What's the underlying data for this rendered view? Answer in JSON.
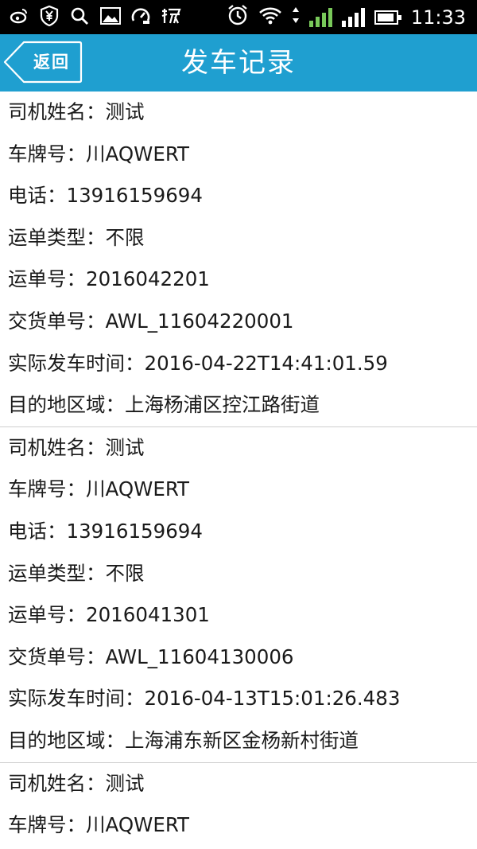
{
  "status_bar": {
    "left_icons": [
      "weibo-icon",
      "yen-shield-icon",
      "search-icon",
      "image-icon",
      "speed-icon",
      "taobao-icon"
    ],
    "right_icons": [
      "alarm-icon",
      "wifi-icon",
      "signal-1-icon",
      "signal-2-icon",
      "battery-icon"
    ],
    "time": "11:33"
  },
  "header": {
    "back_label": "返回",
    "title": "发车记录",
    "color": "#1f9fd0"
  },
  "records": [
    {
      "fields": [
        {
          "label": "司机姓名：",
          "value": "测试"
        },
        {
          "label": "车牌号：",
          "value": "川AQWERT"
        },
        {
          "label": "电话：",
          "value": "13916159694"
        },
        {
          "label": "运单类型：",
          "value": "不限"
        },
        {
          "label": "运单号：",
          "value": "2016042201"
        },
        {
          "label": "交货单号：",
          "value": "AWL_11604220001"
        },
        {
          "label": "实际发车时间：",
          "value": "2016-04-22T14:41:01.59"
        },
        {
          "label": "目的地区域：",
          "value": "上海杨浦区控江路街道"
        }
      ]
    },
    {
      "fields": [
        {
          "label": "司机姓名：",
          "value": "测试"
        },
        {
          "label": "车牌号：",
          "value": "川AQWERT"
        },
        {
          "label": "电话：",
          "value": "13916159694"
        },
        {
          "label": "运单类型：",
          "value": "不限"
        },
        {
          "label": "运单号：",
          "value": "2016041301"
        },
        {
          "label": "交货单号：",
          "value": "AWL_11604130006"
        },
        {
          "label": "实际发车时间：",
          "value": "2016-04-13T15:01:26.483"
        },
        {
          "label": "目的地区域：",
          "value": "上海浦东新区金杨新村街道"
        }
      ]
    },
    {
      "fields": [
        {
          "label": "司机姓名：",
          "value": "测试"
        },
        {
          "label": "车牌号：",
          "value": "川AQWERT"
        }
      ]
    }
  ]
}
